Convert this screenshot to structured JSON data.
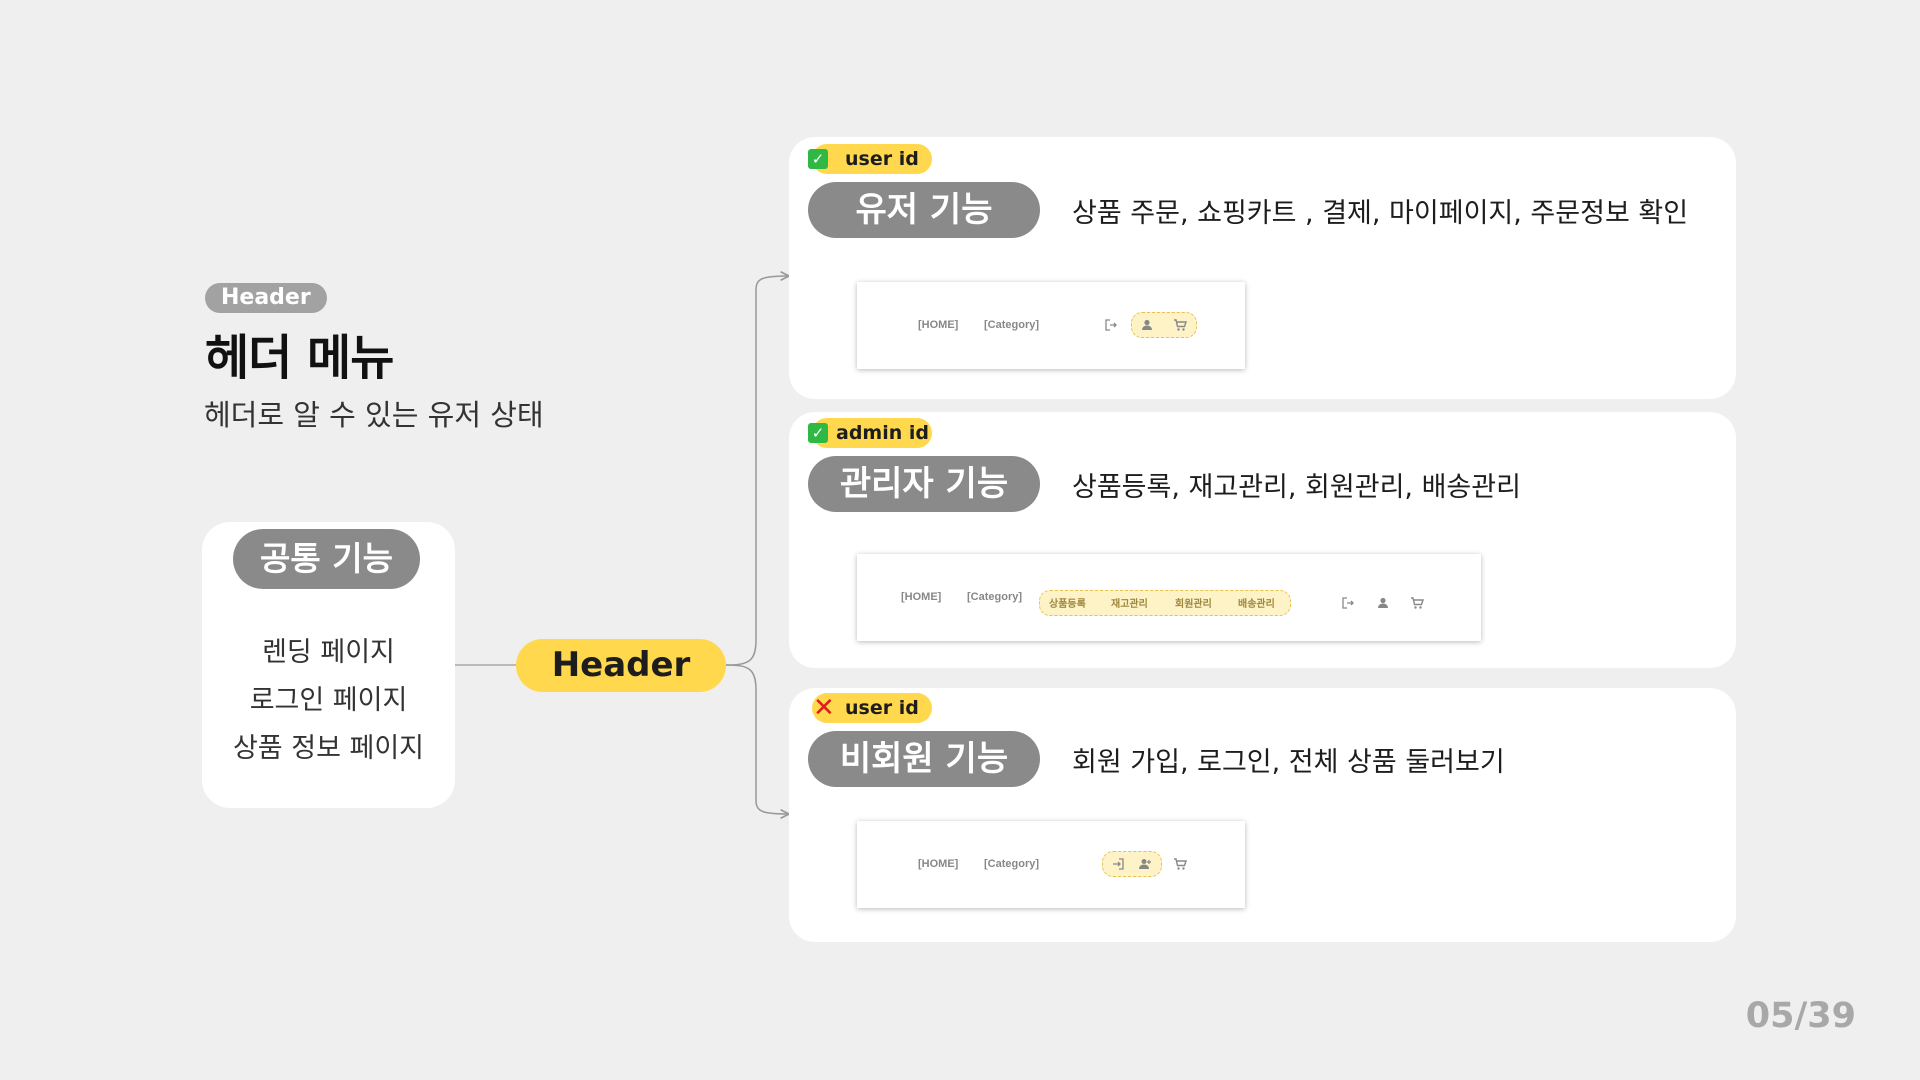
{
  "title_block": {
    "tag": "Header",
    "title": "헤더 메뉴",
    "subtitle": "헤더로 알 수 있는 유저 상태"
  },
  "common": {
    "label": "공통 기능",
    "items": [
      "렌딩 페이지",
      "로그인 페이지",
      "상품 정보 페이지"
    ]
  },
  "center_node": "Header",
  "panels": [
    {
      "status": "check",
      "id_tag": "user id",
      "feature": "유저 기능",
      "description": "상품 주문, 쇼핑카트 , 결제, 마이페이지, 주문정보 확인",
      "mock": {
        "home": "[HOME]",
        "category": "[Category]",
        "icons": [
          "logout-icon",
          "user-icon",
          "cart-icon"
        ]
      }
    },
    {
      "status": "check",
      "id_tag": "admin id",
      "feature": "관리자 기능",
      "description": "상품등록, 재고관리, 회원관리, 배송관리",
      "mock": {
        "home": "[HOME]",
        "category": "[Category]",
        "admin_menu": [
          "상품등록",
          "재고관리",
          "회원관리",
          "배송관리"
        ],
        "icons": [
          "logout-icon",
          "user-icon",
          "cart-icon"
        ]
      }
    },
    {
      "status": "cross",
      "id_tag": "user id",
      "feature": "비회원 기능",
      "description": "회원 가입, 로그인, 전체 상품 둘러보기",
      "mock": {
        "home": "[HOME]",
        "category": "[Category]",
        "icons": [
          "login-icon",
          "add-user-icon",
          "cart-icon"
        ]
      }
    }
  ],
  "page_number": "05/39",
  "colors": {
    "accent": "#ffd84d",
    "pill": "#8a8a8a",
    "background": "#efefef"
  }
}
